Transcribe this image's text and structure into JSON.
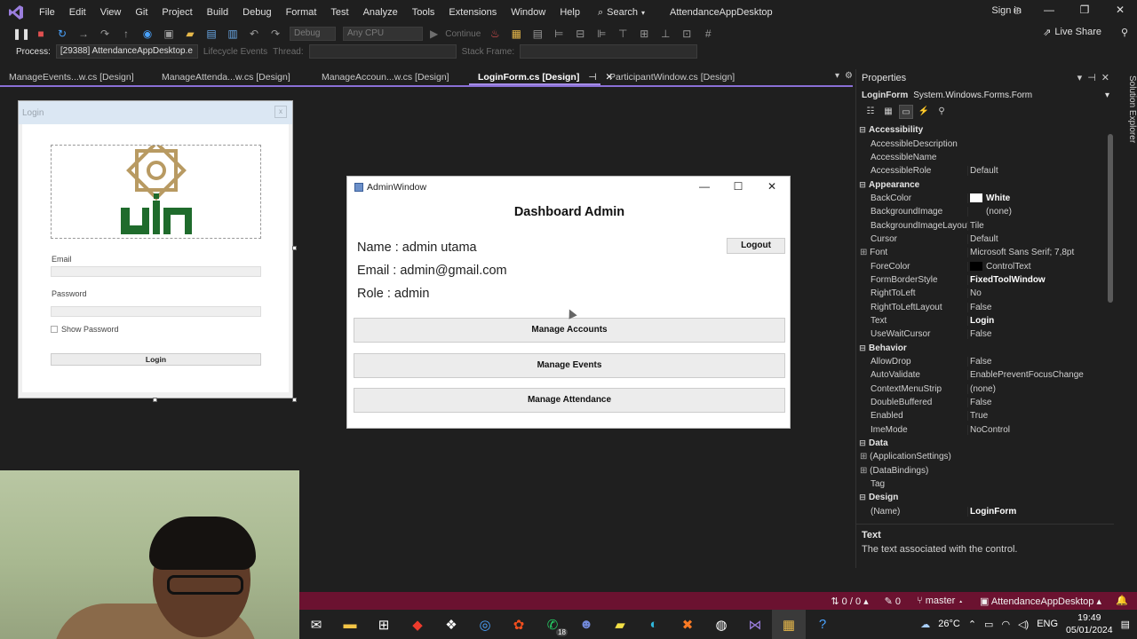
{
  "menu": {
    "items": [
      "File",
      "Edit",
      "View",
      "Git",
      "Project",
      "Build",
      "Debug",
      "Format",
      "Test",
      "Analyze",
      "Tools",
      "Extensions",
      "Window",
      "Help"
    ],
    "search": "Search",
    "app_title": "AttendanceAppDesktop",
    "sign_in": "Sign in"
  },
  "toolbar": {
    "config": "Debug",
    "platform": "Any CPU",
    "continue": "Continue",
    "live_share": "Live Share",
    "process_label": "Process:",
    "process_value": "[29388] AttendanceAppDesktop.e",
    "lifecycle": "Lifecycle Events",
    "thread": "Thread:",
    "stack_frame": "Stack Frame:"
  },
  "tabs": [
    {
      "label": "ManageEvents...w.cs [Design]",
      "active": false
    },
    {
      "label": "ManageAttenda...w.cs [Design]",
      "active": false
    },
    {
      "label": "ManageAccoun...w.cs [Design]",
      "active": false
    },
    {
      "label": "LoginForm.cs [Design]",
      "active": true
    },
    {
      "label": "ParticipantWindow.cs [Design]",
      "active": false
    }
  ],
  "login_form": {
    "title": "Login",
    "close": "x",
    "email_label": "Email",
    "password_label": "Password",
    "show_password": "Show Password",
    "login_button": "Login"
  },
  "admin_window": {
    "title": "AdminWindow",
    "heading": "Dashboard Admin",
    "name": "Name : admin utama",
    "email": "Email : admin@gmail.com",
    "role": "Role : admin",
    "logout": "Logout",
    "buttons": [
      "Manage Accounts",
      "Manage Events",
      "Manage Attendance"
    ]
  },
  "properties": {
    "title": "Properties",
    "object_name": "LoginForm",
    "object_type": "System.Windows.Forms.Form",
    "rows": [
      {
        "cat": true,
        "name": "Accessibility"
      },
      {
        "name": "AccessibleDescription",
        "value": ""
      },
      {
        "name": "AccessibleName",
        "value": ""
      },
      {
        "name": "AccessibleRole",
        "value": "Default"
      },
      {
        "cat": true,
        "name": "Appearance"
      },
      {
        "name": "BackColor",
        "value": "White",
        "bold": true,
        "swatch": "#ffffff"
      },
      {
        "name": "BackgroundImage",
        "value": "(none)",
        "swatch": "#1f1f1f"
      },
      {
        "name": "BackgroundImageLayout",
        "value": "Tile"
      },
      {
        "name": "Cursor",
        "value": "Default"
      },
      {
        "name": "Font",
        "value": "Microsoft Sans Serif; 7,8pt",
        "expand": true
      },
      {
        "name": "ForeColor",
        "value": "ControlText",
        "swatch": "#000000"
      },
      {
        "name": "FormBorderStyle",
        "value": "FixedToolWindow",
        "bold": true
      },
      {
        "name": "RightToLeft",
        "value": "No"
      },
      {
        "name": "RightToLeftLayout",
        "value": "False"
      },
      {
        "name": "Text",
        "value": "Login",
        "bold": true
      },
      {
        "name": "UseWaitCursor",
        "value": "False"
      },
      {
        "cat": true,
        "name": "Behavior"
      },
      {
        "name": "AllowDrop",
        "value": "False"
      },
      {
        "name": "AutoValidate",
        "value": "EnablePreventFocusChange"
      },
      {
        "name": "ContextMenuStrip",
        "value": "(none)"
      },
      {
        "name": "DoubleBuffered",
        "value": "False"
      },
      {
        "name": "Enabled",
        "value": "True"
      },
      {
        "name": "ImeMode",
        "value": "NoControl"
      },
      {
        "cat": true,
        "name": "Data"
      },
      {
        "name": "(ApplicationSettings)",
        "value": "",
        "expand": true
      },
      {
        "name": "(DataBindings)",
        "value": "",
        "expand": true
      },
      {
        "name": "Tag",
        "value": ""
      },
      {
        "cat": true,
        "name": "Design"
      },
      {
        "name": "(Name)",
        "value": "LoginForm",
        "bold": true
      }
    ],
    "desc_title": "Text",
    "desc_text": "The text associated with the control.",
    "solution_explorer": "Solution Explorer"
  },
  "statusbar": {
    "errors": "0 / 0",
    "pencil": "0",
    "branch": "master",
    "project": "AttendanceAppDesktop"
  },
  "taskbar": {
    "weather": "26°C",
    "lang": "ENG",
    "time": "19:49",
    "date": "05/01/2024",
    "whatsapp_badge": "18"
  },
  "colors": {
    "statusbar": "#6b1230",
    "tab_accent": "#a48ce6",
    "logo_gold": "#b89a62",
    "logo_green": "#1f6b2c"
  }
}
